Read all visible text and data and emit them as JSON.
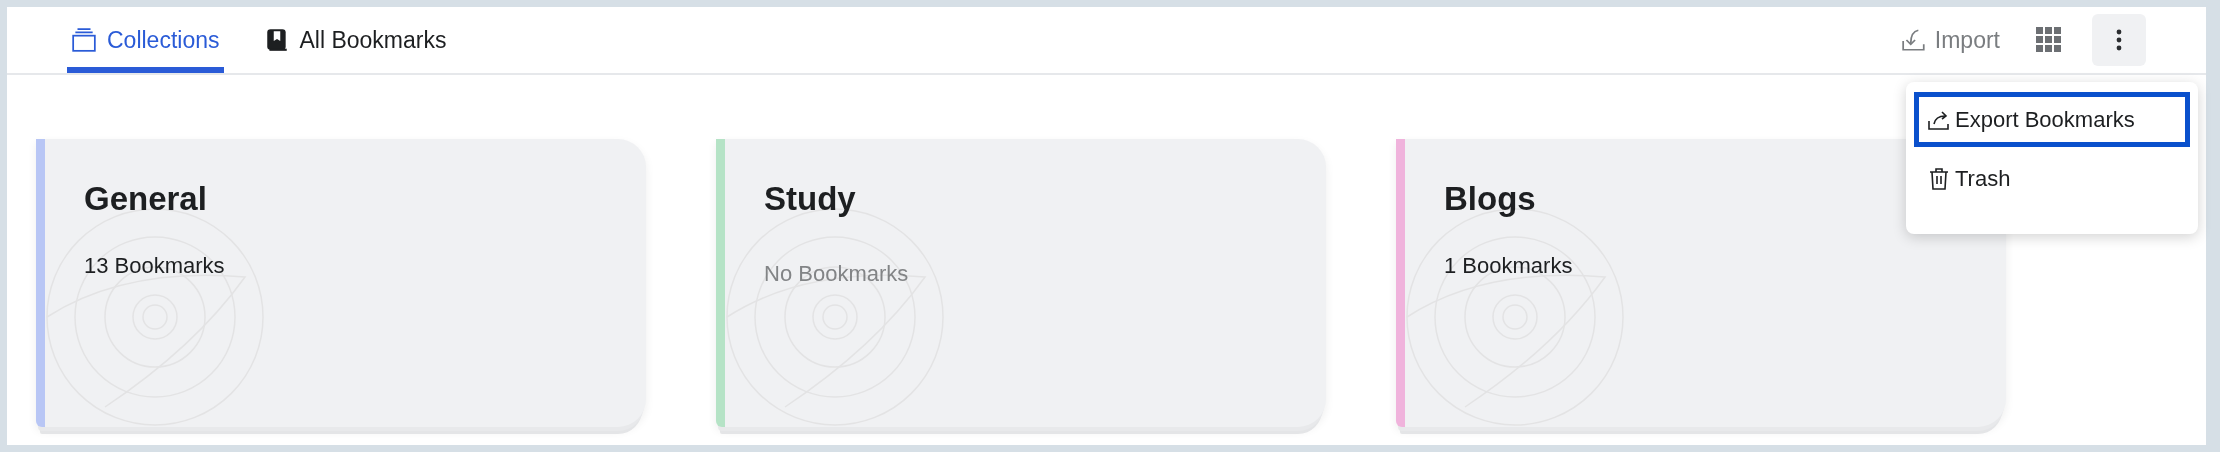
{
  "tabs": [
    {
      "label": "Collections",
      "kind": "stack",
      "selected": true
    },
    {
      "label": "All Bookmarks",
      "kind": "book",
      "selected": false
    }
  ],
  "toolbar": {
    "import_label": "Import"
  },
  "menu": {
    "open": true,
    "items": [
      {
        "label": "Export Bookmarks",
        "kind": "export",
        "selected": true
      },
      {
        "label": "Trash",
        "kind": "trash",
        "selected": false
      }
    ]
  },
  "collections": [
    {
      "name": "General",
      "count": "13 Bookmarks",
      "empty": false,
      "color": "#b8c6f5"
    },
    {
      "name": "Study",
      "count": "No Bookmarks",
      "empty": true,
      "color": "#b5e3c6"
    },
    {
      "name": "Blogs",
      "count": "1 Bookmarks",
      "empty": false,
      "color": "#f0b3dc"
    }
  ]
}
